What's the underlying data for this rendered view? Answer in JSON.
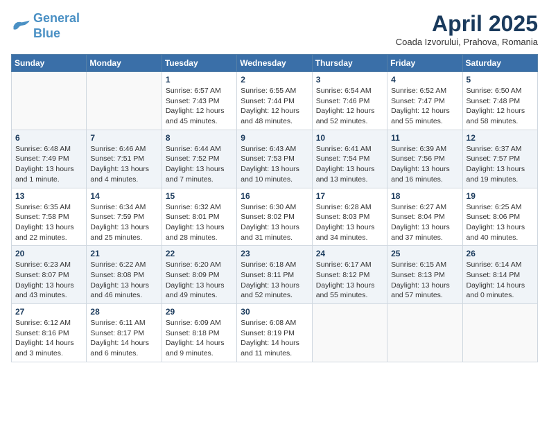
{
  "logo": {
    "line1": "General",
    "line2": "Blue"
  },
  "title": "April 2025",
  "subtitle": "Coada Izvorului, Prahova, Romania",
  "weekdays": [
    "Sunday",
    "Monday",
    "Tuesday",
    "Wednesday",
    "Thursday",
    "Friday",
    "Saturday"
  ],
  "weeks": [
    [
      {
        "day": "",
        "info": ""
      },
      {
        "day": "",
        "info": ""
      },
      {
        "day": "1",
        "info": "Sunrise: 6:57 AM\nSunset: 7:43 PM\nDaylight: 12 hours and 45 minutes."
      },
      {
        "day": "2",
        "info": "Sunrise: 6:55 AM\nSunset: 7:44 PM\nDaylight: 12 hours and 48 minutes."
      },
      {
        "day": "3",
        "info": "Sunrise: 6:54 AM\nSunset: 7:46 PM\nDaylight: 12 hours and 52 minutes."
      },
      {
        "day": "4",
        "info": "Sunrise: 6:52 AM\nSunset: 7:47 PM\nDaylight: 12 hours and 55 minutes."
      },
      {
        "day": "5",
        "info": "Sunrise: 6:50 AM\nSunset: 7:48 PM\nDaylight: 12 hours and 58 minutes."
      }
    ],
    [
      {
        "day": "6",
        "info": "Sunrise: 6:48 AM\nSunset: 7:49 PM\nDaylight: 13 hours and 1 minute."
      },
      {
        "day": "7",
        "info": "Sunrise: 6:46 AM\nSunset: 7:51 PM\nDaylight: 13 hours and 4 minutes."
      },
      {
        "day": "8",
        "info": "Sunrise: 6:44 AM\nSunset: 7:52 PM\nDaylight: 13 hours and 7 minutes."
      },
      {
        "day": "9",
        "info": "Sunrise: 6:43 AM\nSunset: 7:53 PM\nDaylight: 13 hours and 10 minutes."
      },
      {
        "day": "10",
        "info": "Sunrise: 6:41 AM\nSunset: 7:54 PM\nDaylight: 13 hours and 13 minutes."
      },
      {
        "day": "11",
        "info": "Sunrise: 6:39 AM\nSunset: 7:56 PM\nDaylight: 13 hours and 16 minutes."
      },
      {
        "day": "12",
        "info": "Sunrise: 6:37 AM\nSunset: 7:57 PM\nDaylight: 13 hours and 19 minutes."
      }
    ],
    [
      {
        "day": "13",
        "info": "Sunrise: 6:35 AM\nSunset: 7:58 PM\nDaylight: 13 hours and 22 minutes."
      },
      {
        "day": "14",
        "info": "Sunrise: 6:34 AM\nSunset: 7:59 PM\nDaylight: 13 hours and 25 minutes."
      },
      {
        "day": "15",
        "info": "Sunrise: 6:32 AM\nSunset: 8:01 PM\nDaylight: 13 hours and 28 minutes."
      },
      {
        "day": "16",
        "info": "Sunrise: 6:30 AM\nSunset: 8:02 PM\nDaylight: 13 hours and 31 minutes."
      },
      {
        "day": "17",
        "info": "Sunrise: 6:28 AM\nSunset: 8:03 PM\nDaylight: 13 hours and 34 minutes."
      },
      {
        "day": "18",
        "info": "Sunrise: 6:27 AM\nSunset: 8:04 PM\nDaylight: 13 hours and 37 minutes."
      },
      {
        "day": "19",
        "info": "Sunrise: 6:25 AM\nSunset: 8:06 PM\nDaylight: 13 hours and 40 minutes."
      }
    ],
    [
      {
        "day": "20",
        "info": "Sunrise: 6:23 AM\nSunset: 8:07 PM\nDaylight: 13 hours and 43 minutes."
      },
      {
        "day": "21",
        "info": "Sunrise: 6:22 AM\nSunset: 8:08 PM\nDaylight: 13 hours and 46 minutes."
      },
      {
        "day": "22",
        "info": "Sunrise: 6:20 AM\nSunset: 8:09 PM\nDaylight: 13 hours and 49 minutes."
      },
      {
        "day": "23",
        "info": "Sunrise: 6:18 AM\nSunset: 8:11 PM\nDaylight: 13 hours and 52 minutes."
      },
      {
        "day": "24",
        "info": "Sunrise: 6:17 AM\nSunset: 8:12 PM\nDaylight: 13 hours and 55 minutes."
      },
      {
        "day": "25",
        "info": "Sunrise: 6:15 AM\nSunset: 8:13 PM\nDaylight: 13 hours and 57 minutes."
      },
      {
        "day": "26",
        "info": "Sunrise: 6:14 AM\nSunset: 8:14 PM\nDaylight: 14 hours and 0 minutes."
      }
    ],
    [
      {
        "day": "27",
        "info": "Sunrise: 6:12 AM\nSunset: 8:16 PM\nDaylight: 14 hours and 3 minutes."
      },
      {
        "day": "28",
        "info": "Sunrise: 6:11 AM\nSunset: 8:17 PM\nDaylight: 14 hours and 6 minutes."
      },
      {
        "day": "29",
        "info": "Sunrise: 6:09 AM\nSunset: 8:18 PM\nDaylight: 14 hours and 9 minutes."
      },
      {
        "day": "30",
        "info": "Sunrise: 6:08 AM\nSunset: 8:19 PM\nDaylight: 14 hours and 11 minutes."
      },
      {
        "day": "",
        "info": ""
      },
      {
        "day": "",
        "info": ""
      },
      {
        "day": "",
        "info": ""
      }
    ]
  ]
}
